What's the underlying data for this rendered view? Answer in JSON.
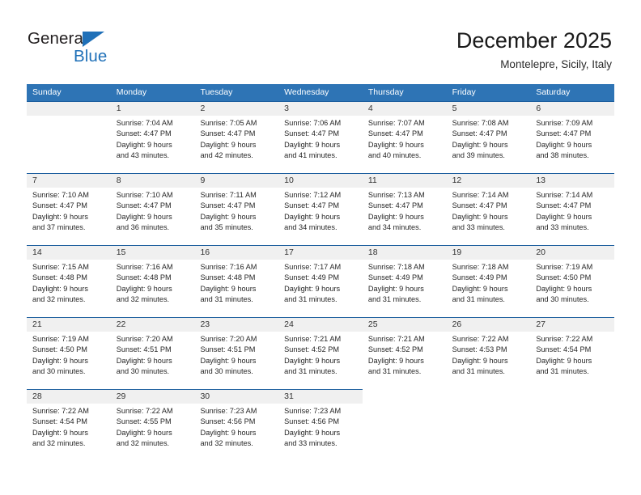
{
  "brand": {
    "name_part1": "General",
    "name_part2": "Blue",
    "triangle_icon": "triangle-logo-icon",
    "color_dark": "#231f20",
    "color_blue": "#1f70b8"
  },
  "header": {
    "title": "December 2025",
    "subtitle": "Montelepre, Sicily, Italy"
  },
  "theme": {
    "header_blue": "#2e74b5",
    "row_rule_blue": "#1c5e9e",
    "daynum_band_gray": "#f0f0f0",
    "text_color": "#262626"
  },
  "weekdays": [
    "Sunday",
    "Monday",
    "Tuesday",
    "Wednesday",
    "Thursday",
    "Friday",
    "Saturday"
  ],
  "weeks": [
    [
      {
        "type": "empty",
        "day": "",
        "sunrise": "",
        "sunset": "",
        "daylight_1": "",
        "daylight_2": ""
      },
      {
        "type": "filled",
        "day": "1",
        "sunrise": "Sunrise: 7:04 AM",
        "sunset": "Sunset: 4:47 PM",
        "daylight_1": "Daylight: 9 hours",
        "daylight_2": "and 43 minutes."
      },
      {
        "type": "filled",
        "day": "2",
        "sunrise": "Sunrise: 7:05 AM",
        "sunset": "Sunset: 4:47 PM",
        "daylight_1": "Daylight: 9 hours",
        "daylight_2": "and 42 minutes."
      },
      {
        "type": "filled",
        "day": "3",
        "sunrise": "Sunrise: 7:06 AM",
        "sunset": "Sunset: 4:47 PM",
        "daylight_1": "Daylight: 9 hours",
        "daylight_2": "and 41 minutes."
      },
      {
        "type": "filled",
        "day": "4",
        "sunrise": "Sunrise: 7:07 AM",
        "sunset": "Sunset: 4:47 PM",
        "daylight_1": "Daylight: 9 hours",
        "daylight_2": "and 40 minutes."
      },
      {
        "type": "filled",
        "day": "5",
        "sunrise": "Sunrise: 7:08 AM",
        "sunset": "Sunset: 4:47 PM",
        "daylight_1": "Daylight: 9 hours",
        "daylight_2": "and 39 minutes."
      },
      {
        "type": "filled",
        "day": "6",
        "sunrise": "Sunrise: 7:09 AM",
        "sunset": "Sunset: 4:47 PM",
        "daylight_1": "Daylight: 9 hours",
        "daylight_2": "and 38 minutes."
      }
    ],
    [
      {
        "type": "filled",
        "day": "7",
        "sunrise": "Sunrise: 7:10 AM",
        "sunset": "Sunset: 4:47 PM",
        "daylight_1": "Daylight: 9 hours",
        "daylight_2": "and 37 minutes."
      },
      {
        "type": "filled",
        "day": "8",
        "sunrise": "Sunrise: 7:10 AM",
        "sunset": "Sunset: 4:47 PM",
        "daylight_1": "Daylight: 9 hours",
        "daylight_2": "and 36 minutes."
      },
      {
        "type": "filled",
        "day": "9",
        "sunrise": "Sunrise: 7:11 AM",
        "sunset": "Sunset: 4:47 PM",
        "daylight_1": "Daylight: 9 hours",
        "daylight_2": "and 35 minutes."
      },
      {
        "type": "filled",
        "day": "10",
        "sunrise": "Sunrise: 7:12 AM",
        "sunset": "Sunset: 4:47 PM",
        "daylight_1": "Daylight: 9 hours",
        "daylight_2": "and 34 minutes."
      },
      {
        "type": "filled",
        "day": "11",
        "sunrise": "Sunrise: 7:13 AM",
        "sunset": "Sunset: 4:47 PM",
        "daylight_1": "Daylight: 9 hours",
        "daylight_2": "and 34 minutes."
      },
      {
        "type": "filled",
        "day": "12",
        "sunrise": "Sunrise: 7:14 AM",
        "sunset": "Sunset: 4:47 PM",
        "daylight_1": "Daylight: 9 hours",
        "daylight_2": "and 33 minutes."
      },
      {
        "type": "filled",
        "day": "13",
        "sunrise": "Sunrise: 7:14 AM",
        "sunset": "Sunset: 4:47 PM",
        "daylight_1": "Daylight: 9 hours",
        "daylight_2": "and 33 minutes."
      }
    ],
    [
      {
        "type": "filled",
        "day": "14",
        "sunrise": "Sunrise: 7:15 AM",
        "sunset": "Sunset: 4:48 PM",
        "daylight_1": "Daylight: 9 hours",
        "daylight_2": "and 32 minutes."
      },
      {
        "type": "filled",
        "day": "15",
        "sunrise": "Sunrise: 7:16 AM",
        "sunset": "Sunset: 4:48 PM",
        "daylight_1": "Daylight: 9 hours",
        "daylight_2": "and 32 minutes."
      },
      {
        "type": "filled",
        "day": "16",
        "sunrise": "Sunrise: 7:16 AM",
        "sunset": "Sunset: 4:48 PM",
        "daylight_1": "Daylight: 9 hours",
        "daylight_2": "and 31 minutes."
      },
      {
        "type": "filled",
        "day": "17",
        "sunrise": "Sunrise: 7:17 AM",
        "sunset": "Sunset: 4:49 PM",
        "daylight_1": "Daylight: 9 hours",
        "daylight_2": "and 31 minutes."
      },
      {
        "type": "filled",
        "day": "18",
        "sunrise": "Sunrise: 7:18 AM",
        "sunset": "Sunset: 4:49 PM",
        "daylight_1": "Daylight: 9 hours",
        "daylight_2": "and 31 minutes."
      },
      {
        "type": "filled",
        "day": "19",
        "sunrise": "Sunrise: 7:18 AM",
        "sunset": "Sunset: 4:49 PM",
        "daylight_1": "Daylight: 9 hours",
        "daylight_2": "and 31 minutes."
      },
      {
        "type": "filled",
        "day": "20",
        "sunrise": "Sunrise: 7:19 AM",
        "sunset": "Sunset: 4:50 PM",
        "daylight_1": "Daylight: 9 hours",
        "daylight_2": "and 30 minutes."
      }
    ],
    [
      {
        "type": "filled",
        "day": "21",
        "sunrise": "Sunrise: 7:19 AM",
        "sunset": "Sunset: 4:50 PM",
        "daylight_1": "Daylight: 9 hours",
        "daylight_2": "and 30 minutes."
      },
      {
        "type": "filled",
        "day": "22",
        "sunrise": "Sunrise: 7:20 AM",
        "sunset": "Sunset: 4:51 PM",
        "daylight_1": "Daylight: 9 hours",
        "daylight_2": "and 30 minutes."
      },
      {
        "type": "filled",
        "day": "23",
        "sunrise": "Sunrise: 7:20 AM",
        "sunset": "Sunset: 4:51 PM",
        "daylight_1": "Daylight: 9 hours",
        "daylight_2": "and 30 minutes."
      },
      {
        "type": "filled",
        "day": "24",
        "sunrise": "Sunrise: 7:21 AM",
        "sunset": "Sunset: 4:52 PM",
        "daylight_1": "Daylight: 9 hours",
        "daylight_2": "and 31 minutes."
      },
      {
        "type": "filled",
        "day": "25",
        "sunrise": "Sunrise: 7:21 AM",
        "sunset": "Sunset: 4:52 PM",
        "daylight_1": "Daylight: 9 hours",
        "daylight_2": "and 31 minutes."
      },
      {
        "type": "filled",
        "day": "26",
        "sunrise": "Sunrise: 7:22 AM",
        "sunset": "Sunset: 4:53 PM",
        "daylight_1": "Daylight: 9 hours",
        "daylight_2": "and 31 minutes."
      },
      {
        "type": "filled",
        "day": "27",
        "sunrise": "Sunrise: 7:22 AM",
        "sunset": "Sunset: 4:54 PM",
        "daylight_1": "Daylight: 9 hours",
        "daylight_2": "and 31 minutes."
      }
    ],
    [
      {
        "type": "filled",
        "day": "28",
        "sunrise": "Sunrise: 7:22 AM",
        "sunset": "Sunset: 4:54 PM",
        "daylight_1": "Daylight: 9 hours",
        "daylight_2": "and 32 minutes."
      },
      {
        "type": "filled",
        "day": "29",
        "sunrise": "Sunrise: 7:22 AM",
        "sunset": "Sunset: 4:55 PM",
        "daylight_1": "Daylight: 9 hours",
        "daylight_2": "and 32 minutes."
      },
      {
        "type": "filled",
        "day": "30",
        "sunrise": "Sunrise: 7:23 AM",
        "sunset": "Sunset: 4:56 PM",
        "daylight_1": "Daylight: 9 hours",
        "daylight_2": "and 32 minutes."
      },
      {
        "type": "filled",
        "day": "31",
        "sunrise": "Sunrise: 7:23 AM",
        "sunset": "Sunset: 4:56 PM",
        "daylight_1": "Daylight: 9 hours",
        "daylight_2": "and 33 minutes."
      },
      {
        "type": "blank",
        "day": "",
        "sunrise": "",
        "sunset": "",
        "daylight_1": "",
        "daylight_2": ""
      },
      {
        "type": "blank",
        "day": "",
        "sunrise": "",
        "sunset": "",
        "daylight_1": "",
        "daylight_2": ""
      },
      {
        "type": "blank",
        "day": "",
        "sunrise": "",
        "sunset": "",
        "daylight_1": "",
        "daylight_2": ""
      }
    ]
  ]
}
